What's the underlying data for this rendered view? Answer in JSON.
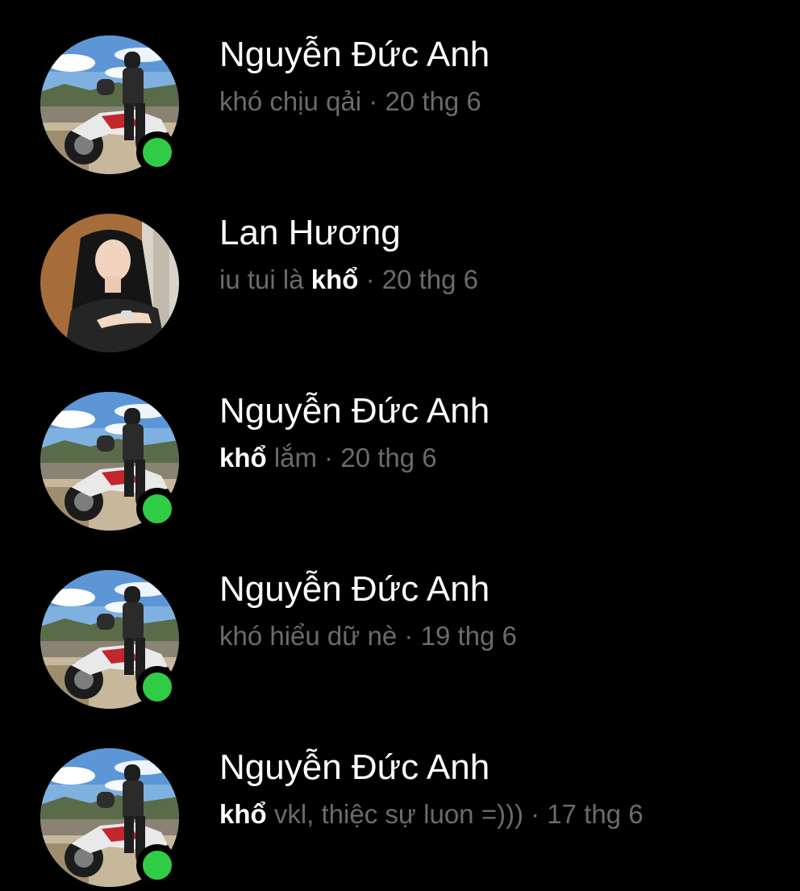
{
  "conversations": [
    {
      "name": "Nguyễn Đức Anh",
      "avatar": "photo-man-on-motorbike",
      "online": true,
      "preview": {
        "before": "khó chịu qải",
        "highlight": "",
        "after": ""
      },
      "separator": " · ",
      "date": "20 thg 6"
    },
    {
      "name": "Lan Hương",
      "avatar": "photo-girl-long-hair",
      "online": false,
      "preview": {
        "before": "iu tui là ",
        "highlight": "khổ",
        "after": ""
      },
      "separator": " · ",
      "date": "20 thg 6"
    },
    {
      "name": "Nguyễn Đức Anh",
      "avatar": "photo-man-on-motorbike",
      "online": true,
      "preview": {
        "before": "",
        "highlight": "khổ",
        "after": " lắm"
      },
      "separator": " · ",
      "date": "20 thg 6"
    },
    {
      "name": "Nguyễn Đức Anh",
      "avatar": "photo-man-on-motorbike",
      "online": true,
      "preview": {
        "before": "khó hiểu dữ nè",
        "highlight": "",
        "after": ""
      },
      "separator": " · ",
      "date": "19 thg 6"
    },
    {
      "name": "Nguyễn Đức Anh",
      "avatar": "photo-man-on-motorbike",
      "online": true,
      "preview": {
        "before": "",
        "highlight": "khổ",
        "after": " vkl, thiệc sự luon =)))"
      },
      "separator": " · ",
      "date": "17 thg 6"
    }
  ],
  "colors": {
    "background": "#000000",
    "name": "#ffffff",
    "preview": "#6b6b6b",
    "highlight": "#ffffff",
    "online": "#31cc46"
  }
}
